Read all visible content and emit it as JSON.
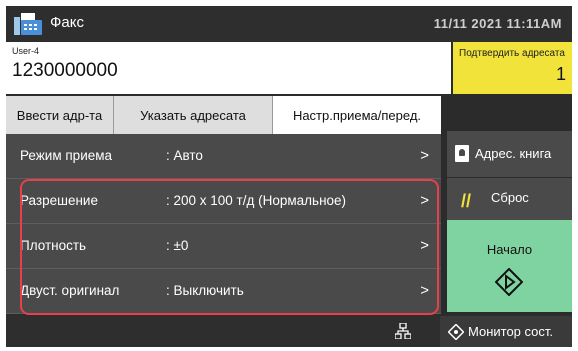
{
  "header": {
    "title": "Факс",
    "clock": "11/11 2021 11:11AM"
  },
  "destination": {
    "user": "User-4",
    "number": "1230000000"
  },
  "confirm": {
    "label": "Подтвердить адресата",
    "count": "1"
  },
  "tabs": [
    {
      "label": "Ввести адр-та"
    },
    {
      "label": "Указать адресата"
    },
    {
      "label": "Настр.приема/перед."
    }
  ],
  "settings": [
    {
      "label": "Режим приема",
      "value": ":  Авто"
    },
    {
      "label": "Разрешение",
      "value": ":  200 x 100 т/д (Нормальное)"
    },
    {
      "label": "Плотность",
      "value": ":  ±0"
    },
    {
      "label": "Двуст. оригинал",
      "value": ":  Выключить"
    }
  ],
  "side": {
    "address_book": "Адрес. книга",
    "reset": "Сброс",
    "start": "Начало"
  },
  "bottom": {
    "monitor": "Монитор сост."
  },
  "colors": {
    "confirm_bg": "#f2e33a",
    "start_bg": "#7ed3a0",
    "highlight": "#e8404a",
    "reset_icon": "#f2e33a"
  }
}
